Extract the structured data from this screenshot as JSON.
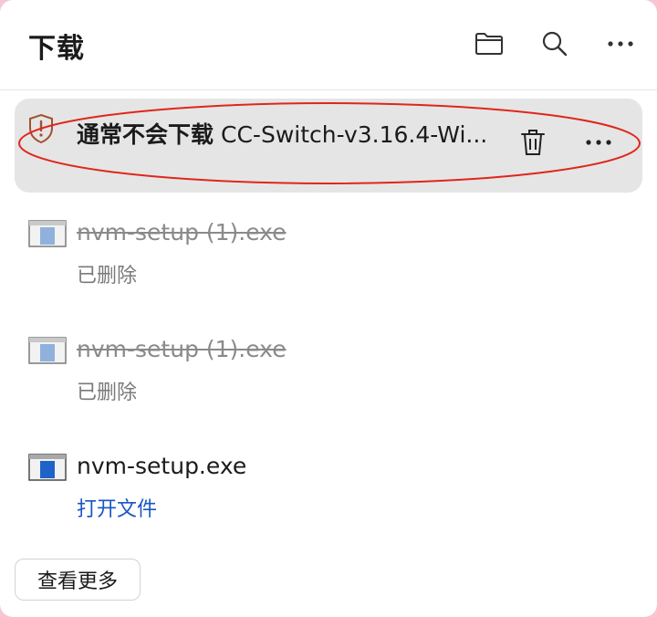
{
  "header": {
    "title": "下载",
    "icons": [
      "folder-icon",
      "search-icon",
      "more-icon"
    ]
  },
  "warning_item": {
    "status": "通常不会下载",
    "filename": "CC-Switch-v3.16.4-Wi...",
    "icons": [
      "shield-warning-icon",
      "trash-icon",
      "more-icon"
    ],
    "annotation_color": "#e0261b"
  },
  "downloads": [
    {
      "filename": "nvm-setup (1).exe",
      "status": "已删除",
      "deleted": true
    },
    {
      "filename": "nvm-setup (1).exe",
      "status": "已删除",
      "deleted": true
    },
    {
      "filename": "nvm-setup.exe",
      "action": "打开文件",
      "deleted": false
    }
  ],
  "footer": {
    "see_more_label": "查看更多"
  },
  "colors": {
    "link": "#1a56c4",
    "warn_bg": "#e5e5e5",
    "shield": "#a0522d"
  }
}
